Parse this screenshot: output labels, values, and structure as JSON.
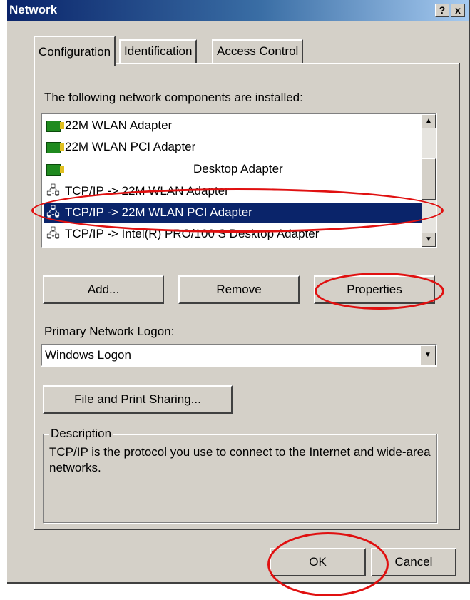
{
  "window": {
    "title": "Network"
  },
  "titlebar_buttons": {
    "help": "?",
    "close": "x"
  },
  "tabs": [
    {
      "label": "Configuration"
    },
    {
      "label": "Identification"
    },
    {
      "label": "Access Control"
    }
  ],
  "components": {
    "label": "The following network components are installed:",
    "items": [
      {
        "label": "22M WLAN Adapter",
        "icon": "network-adapter-icon"
      },
      {
        "label": "22M WLAN PCI Adapter",
        "icon": "network-adapter-icon"
      },
      {
        "label": "Desktop Adapter",
        "icon": "network-adapter-icon"
      },
      {
        "label": "TCP/IP -> 22M WLAN Adapter",
        "icon": "protocol-icon"
      },
      {
        "label": "TCP/IP -> 22M WLAN PCI Adapter",
        "icon": "protocol-icon",
        "selected": true
      },
      {
        "label": "TCP/IP -> Intel(R) PRO/100 S Desktop Adapter",
        "icon": "protocol-icon"
      }
    ]
  },
  "buttons": {
    "add": "Add...",
    "remove": "Remove",
    "properties": "Properties",
    "file_print": "File and Print Sharing...",
    "ok": "OK",
    "cancel": "Cancel"
  },
  "logon": {
    "label": "Primary Network Logon:",
    "value": "Windows Logon"
  },
  "description": {
    "title": "Description",
    "text": "TCP/IP is the protocol you use to connect to the Internet and wide-area networks."
  },
  "colors": {
    "highlight": "#0a246a",
    "annotation": "#e01010",
    "dialog_bg": "#d4d0c8"
  }
}
